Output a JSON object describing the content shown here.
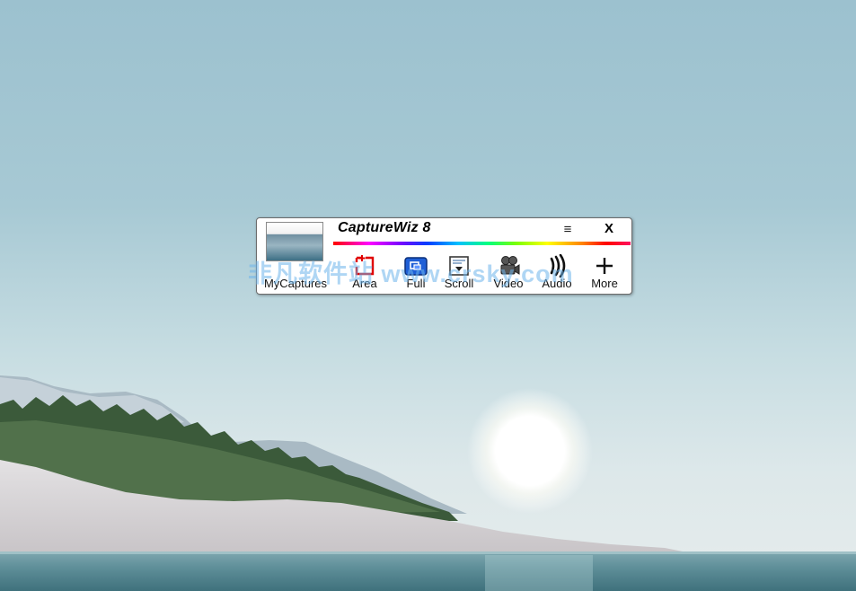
{
  "app": {
    "title": "CaptureWiz 8",
    "menu_label": "≡",
    "close_label": "X"
  },
  "toolbar": [
    {
      "label": "MyCaptures",
      "icon": "thumbnail-icon"
    },
    {
      "label": "Area",
      "icon": "area-capture-icon"
    },
    {
      "label": "Full",
      "icon": "full-screen-icon"
    },
    {
      "label": "Scroll",
      "icon": "scroll-capture-icon"
    },
    {
      "label": "Video",
      "icon": "video-camera-icon"
    },
    {
      "label": "Audio",
      "icon": "audio-icon"
    },
    {
      "label": "More",
      "icon": "plus-icon"
    }
  ],
  "watermark": "非凡软件站 www.crsky.com",
  "colors": {
    "area_red": "#e00000",
    "full_blue": "#1f5fd6",
    "widget_bg": "#ffffff"
  }
}
